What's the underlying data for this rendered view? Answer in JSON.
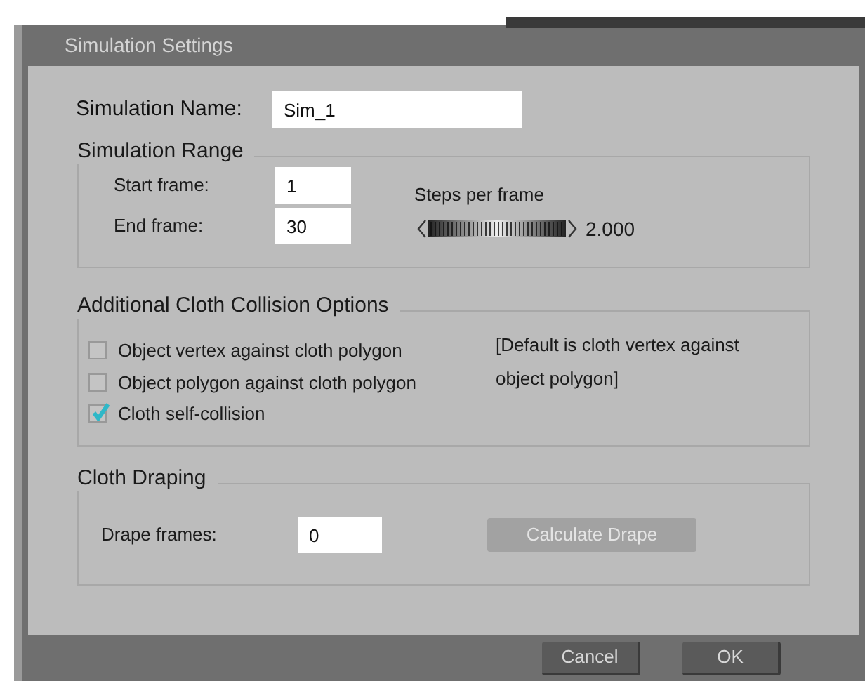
{
  "window": {
    "title": "Simulation Settings"
  },
  "simulation_name": {
    "label": "Simulation Name:",
    "value": "Sim_1"
  },
  "simulation_range": {
    "title": "Simulation Range",
    "start": {
      "label": "Start frame:",
      "value": "1"
    },
    "end": {
      "label": "End frame:",
      "value": "30"
    },
    "steps": {
      "label": "Steps per frame",
      "reading": "2.000"
    }
  },
  "collision": {
    "title": "Additional Cloth Collision Options",
    "options": [
      {
        "label": "Object vertex against cloth polygon",
        "checked": false
      },
      {
        "label": "Object polygon against cloth polygon",
        "checked": false
      },
      {
        "label": "Cloth self-collision",
        "checked": true
      }
    ],
    "note": "[Default is cloth vertex against object polygon]"
  },
  "draping": {
    "title": "Cloth Draping",
    "drape_frames": {
      "label": "Drape frames:",
      "value": "0"
    },
    "calculate_button": {
      "label": "Calculate Drape",
      "disabled": true
    }
  },
  "buttons": [
    {
      "label": "Cancel"
    },
    {
      "label": "OK"
    }
  ]
}
